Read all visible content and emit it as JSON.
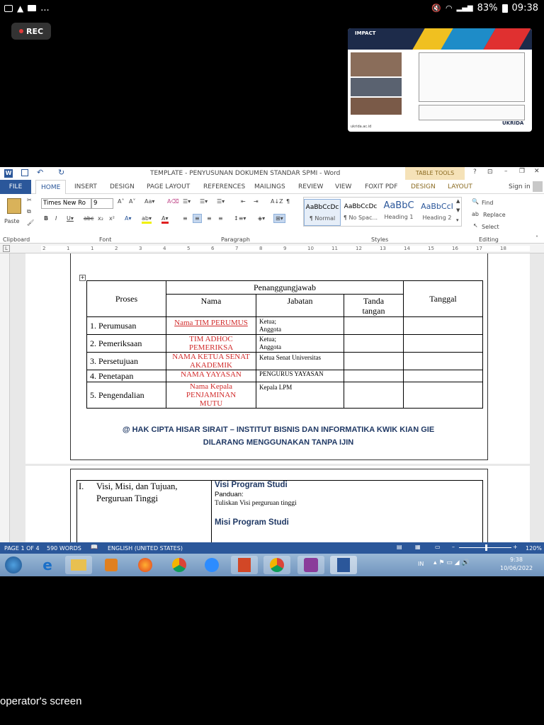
{
  "status_bar": {
    "notif_dots": "...",
    "battery": "83%",
    "time": "09:38"
  },
  "rec_label": "REC",
  "thumbnail": {
    "brand": "IMPACT",
    "logo": "UKRIDA",
    "footer": "ukrida.ac.id"
  },
  "word": {
    "title": "TEMPLATE - PENYUSUNAN DOKUMEN  STANDAR SPMI - Word",
    "table_tools": "TABLE TOOLS",
    "tabs": [
      "FILE",
      "HOME",
      "INSERT",
      "DESIGN",
      "PAGE LAYOUT",
      "REFERENCES",
      "MAILINGS",
      "REVIEW",
      "VIEW",
      "FOXIT PDF",
      "DESIGN",
      "LAYOUT"
    ],
    "sign_in": "Sign in",
    "font_name": "Times New Ro",
    "font_size": "9",
    "paste": "Paste",
    "groups": {
      "clipboard": "Clipboard",
      "font": "Font",
      "paragraph": "Paragraph",
      "styles": "Styles",
      "editing": "Editing"
    },
    "styles": [
      {
        "preview": "AaBbCcDc",
        "name": "¶ Normal"
      },
      {
        "preview": "AaBbCcDc",
        "name": "¶ No Spac..."
      },
      {
        "preview": "AaBbC",
        "name": "Heading 1"
      },
      {
        "preview": "AaBbCcI",
        "name": "Heading 2"
      }
    ],
    "editing": {
      "find": "Find",
      "replace": "Replace",
      "select": "Select"
    },
    "ruler_numbers": [
      "2",
      "1",
      "1",
      "2",
      "3",
      "4",
      "5",
      "6",
      "7",
      "8",
      "9",
      "10",
      "11",
      "12",
      "13",
      "14",
      "15",
      "16",
      "17",
      "18"
    ],
    "status": {
      "page": "PAGE 1 OF 4",
      "words": "590 WORDS",
      "language": "ENGLISH (UNITED STATES)",
      "zoom": "120%"
    },
    "taskbar": {
      "lang": "IN",
      "time": "9:38",
      "date": "10/06/2022"
    }
  },
  "document": {
    "table": {
      "header_group": "Penanggungjawab",
      "h_proses": "Proses",
      "h_nama": "Nama",
      "h_jabatan": "Jabatan",
      "h_tanda": "Tanda tangan",
      "h_tanggal": "Tanggal",
      "rows": [
        {
          "proses": "1.   Perumusan",
          "nama": "Nama TIM PERUMUS",
          "jabatan": "Ketua; Anggota"
        },
        {
          "proses": "2.   Pemeriksaan",
          "nama": "TIM ADHOC PEMERIKSA",
          "jabatan": "Ketua; Anggota"
        },
        {
          "proses": "3.   Persetujuan",
          "nama": "NAMA KETUA SENAT AKADEMIK",
          "jabatan": "Ketua Senat Universitas"
        },
        {
          "proses": "4.   Penetapan",
          "nama": "NAMA YAYASAN",
          "jabatan": "PENGURUS YAYASAN"
        },
        {
          "proses": "5.   Pengendalian",
          "nama": "Nama Kepala PENJAMINAN MUTU",
          "jabatan": "Kepala LPM"
        }
      ]
    },
    "copyright_line1": "@ HAK CIPTA HISAR SIRAIT – INSTITUT BISNIS DAN INFORMATIKA KWIK KIAN GIE",
    "copyright_line2": "DILARANG MENGGUNAKAN TANPA IJIN",
    "page2": {
      "item_num": "I.",
      "item_text": "Visi, Misi, dan Tujuan, Perguruan Tinggi",
      "visi_title": "Visi Program Studi",
      "panduan": "Panduan:",
      "visi_hint": "Tuliskan Visi perguruan tinggi",
      "misi_title": "Misi Program Studi"
    }
  },
  "caption": "operator's screen"
}
